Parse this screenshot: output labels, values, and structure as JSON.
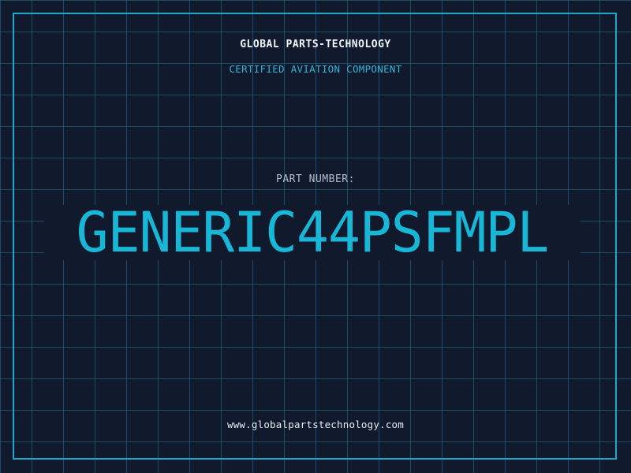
{
  "header": {
    "brand": "GLOBAL PARTS-TECHNOLOGY",
    "tagline": "CERTIFIED AVIATION COMPONENT"
  },
  "main": {
    "part_label": "PART NUMBER:",
    "part_number": "GENERIC44PSFMPL"
  },
  "footer": {
    "website": "www.globalpartstechnology.com"
  },
  "colors": {
    "background": "#111a2d",
    "grid": "#22788f",
    "frame": "#1ea7c8",
    "accent": "#18b7d8",
    "text": "#f2f5f8"
  }
}
